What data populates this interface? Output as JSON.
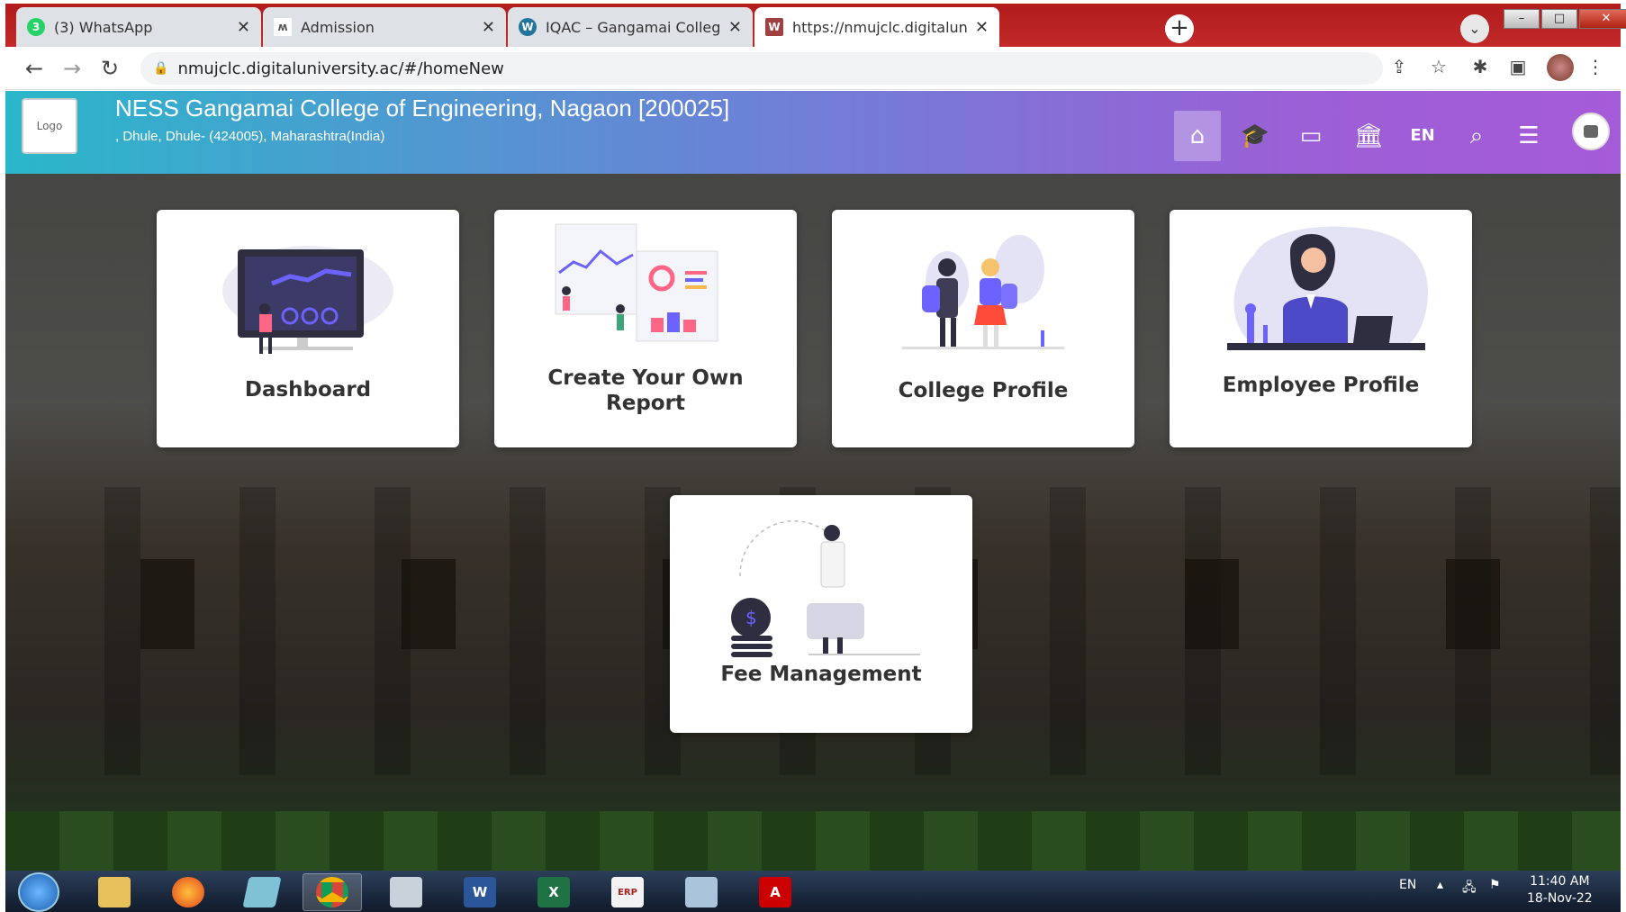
{
  "browser": {
    "tabs": [
      {
        "label": "(3) WhatsApp",
        "icon": "whatsapp-icon",
        "color": "#25d366",
        "active": false
      },
      {
        "label": "Admission",
        "icon": "admission-icon",
        "color": "#555555",
        "active": false
      },
      {
        "label": "IQAC – Gangamai College of Eng",
        "icon": "wordpress-icon",
        "color": "#21759b",
        "active": false
      },
      {
        "label": "https://nmujclc.digitaluniversity.a",
        "icon": "digitaluniversity-icon",
        "color": "#a04040",
        "active": true
      }
    ],
    "address": "nmujclc.digitaluniversity.ac/#/homeNew"
  },
  "header": {
    "logo_text": "Logo",
    "college_name": "NESS Gangamai College of Engineering, Nagaon [200025]",
    "address": ", Dhule, Dhule- (424005), Maharashtra(India)",
    "lang": "EN",
    "icons": [
      "home-icon",
      "graduation-cap-icon",
      "card-icon",
      "institution-icon",
      "search-icon",
      "menu-icon"
    ]
  },
  "cards": [
    {
      "label": "Dashboard"
    },
    {
      "label_line1": "Create Your Own",
      "label_line2": "Report"
    },
    {
      "label": "College Profile"
    },
    {
      "label": "Employee Profile"
    },
    {
      "label": "Fee Management"
    }
  ],
  "taskbar": {
    "lang": "EN",
    "time": "11:40 AM",
    "date": "18-Nov-22",
    "apps": [
      "file-explorer-icon",
      "firefox-icon",
      "sticky-icon",
      "chrome-icon",
      "network-icon",
      "word-icon",
      "excel-icon",
      "tally-icon",
      "calculator-icon",
      "acrobat-icon"
    ]
  }
}
